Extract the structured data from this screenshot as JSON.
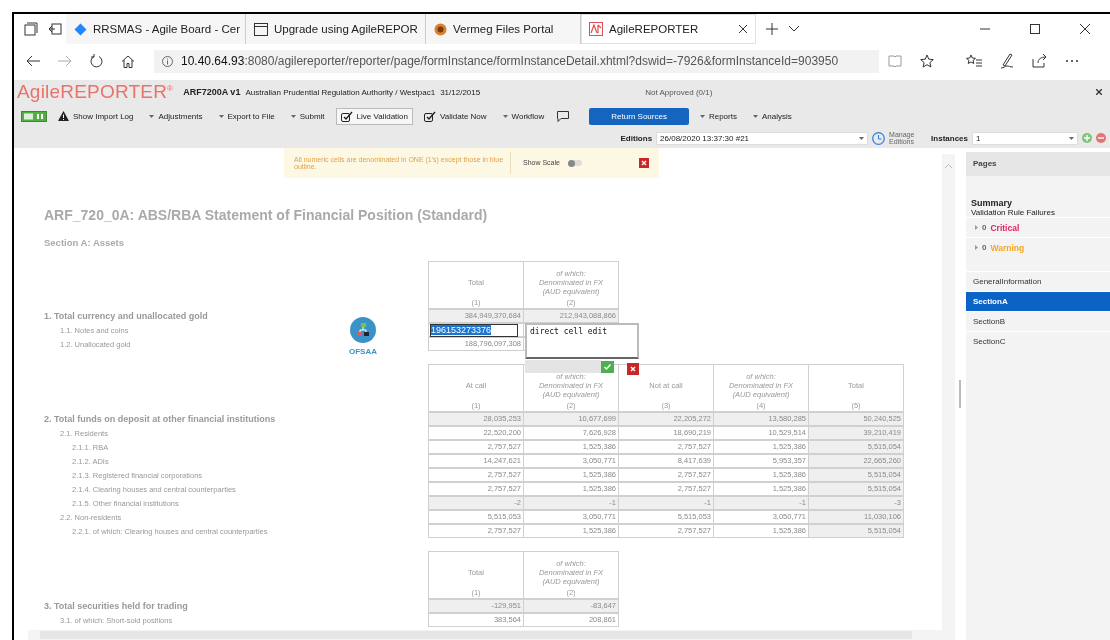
{
  "browser": {
    "tabs": [
      {
        "title": "RRSMAS - Agile Board - Cer",
        "selected": false
      },
      {
        "title": "Upgrade using AgileREPOR",
        "selected": false
      },
      {
        "title": "Vermeg Files Portal",
        "selected": false
      },
      {
        "title": "AgileREPORTER",
        "selected": true
      }
    ],
    "url": {
      "host": "10.40.64.93",
      "path": ":8080/agilereporter/reporter/page/formInstance/formInstanceDetail.xhtml?dswid=-7926&formInstanceId=903950"
    }
  },
  "app": {
    "logo": "AgileREPORTER$^{®}$",
    "form": "ARF7200A v1",
    "entity": "Australian Prudential Regulation Authority / Westpac1",
    "date": "31/12/2015",
    "status": "Not Approved (0/1)"
  },
  "toolbar": [
    {
      "kind": "toggle"
    },
    {
      "kind": "warning",
      "label": "Show Import Log"
    },
    {
      "kind": "menu",
      "label": "Adjustments"
    },
    {
      "kind": "menu",
      "label": "Export to File"
    },
    {
      "kind": "menu",
      "label": "Submit"
    },
    {
      "kind": "validate",
      "label": "Live Validation",
      "pressed": true
    },
    {
      "kind": "validate",
      "label": "Validate Now",
      "pressed": false
    },
    {
      "kind": "menu",
      "label": "Workflow"
    },
    {
      "kind": "comment"
    },
    {
      "kind": "primary",
      "label": "Return Sources"
    },
    {
      "kind": "menu",
      "label": "Reports"
    },
    {
      "kind": "menu",
      "label": "Analysis"
    }
  ],
  "editions": {
    "label": "Editions",
    "value": "26/08/2020 13:37:30 #21",
    "manage": "Manage Editions",
    "instances_label": "Instances",
    "instances_value": "1"
  },
  "notice": {
    "text": "All numeric cells are denominated in ONE (1's) except those in blue outline.",
    "scale_label": "Show Scale",
    "scale_on": false
  },
  "form": {
    "title": "ARF_720_0A: ABS/RBA Statement of Financial Position (Standard)",
    "section": "Section A: Assets",
    "blocks": [
      {
        "badge": {
          "label": "OFSAA"
        },
        "columns": [
          {
            "label": "Total",
            "number": "(1)",
            "kind": "plain",
            "computed": false
          },
          {
            "label": "of which:\nDenominated in FX\n(AUD equivalent)",
            "number": "(2)",
            "kind": "italic",
            "computed": false
          }
        ],
        "rows": [
          {
            "label": "1. Total currency and unallocated gold",
            "values": [
              "384,949,370,684",
              "212,943,088,866"
            ],
            "computed": true,
            "children": [
              {
                "label": "1.1. Notes and coins",
                "computed": false,
                "editor": {
                  "value": "196153273376",
                  "comment": "direct cell edit"
                }
              },
              {
                "label": "1.2. Unallocated gold",
                "values": [
                  "188,796,097,308"
                ],
                "computed": false
              }
            ]
          }
        ]
      },
      {
        "columns": [
          {
            "label": "At call",
            "number": "(1)",
            "kind": "plain",
            "computed": false
          },
          {
            "label": "of which:\nDenominated in FX\n(AUD equivalent)",
            "number": "(2)",
            "kind": "italic",
            "computed": false
          },
          {
            "label": "Not at call",
            "number": "(3)",
            "kind": "plain",
            "computed": false
          },
          {
            "label": "of which:\nDenominated in FX\n(AUD equivalent)",
            "number": "(4)",
            "kind": "italic",
            "computed": false
          },
          {
            "label": "Total",
            "number": "(5)",
            "kind": "plain",
            "computed": true
          }
        ],
        "rows": [
          {
            "label": "2. Total funds on deposit at other financial institutions",
            "values": [
              "28,035,253",
              "10,677,699",
              "22,205,272",
              "13,580,285",
              "50,240,525"
            ],
            "computed": true,
            "children": [
              {
                "label": "2.1. Residents",
                "values": [
                  "22,520,200",
                  "7,626,928",
                  "18,690,219",
                  "10,529,514",
                  "39,210,419"
                ],
                "computed": false,
                "children": [
                  {
                    "label": "2.1.1. RBA",
                    "values": [
                      "2,757,527",
                      "1,525,386",
                      "2,757,527",
                      "1,525,386",
                      "5,515,054"
                    ],
                    "computed": false
                  },
                  {
                    "label": "2.1.2. ADIs",
                    "values": [
                      "14,247,621",
                      "3,050,771",
                      "8,417,639",
                      "5,953,357",
                      "22,665,260"
                    ],
                    "computed": false
                  },
                  {
                    "label": "2.1.3. Registered financial corporations",
                    "values": [
                      "2,757,527",
                      "1,525,386",
                      "2,757,527",
                      "1,525,386",
                      "5,515,054"
                    ],
                    "computed": false
                  },
                  {
                    "label": "2.1.4. Clearing houses and central counterparties",
                    "values": [
                      "2,757,527",
                      "1,525,386",
                      "2,757,527",
                      "1,525,386",
                      "5,515,054"
                    ],
                    "computed": false
                  },
                  {
                    "label": "2.1.5. Other financial institutions",
                    "values": [
                      "-2",
                      "-1",
                      "-1",
                      "-1",
                      "-3"
                    ],
                    "computed": true
                  }
                ]
              },
              {
                "label": "2.2. Non-residents",
                "values": [
                  "5,515,053",
                  "3,050,771",
                  "5,515,053",
                  "3,050,771",
                  "11,030,106"
                ],
                "computed": false,
                "children": [
                  {
                    "label": "2.2.1. of which: Clearing houses and central counterparties",
                    "values": [
                      "2,757,527",
                      "1,525,386",
                      "2,757,527",
                      "1,525,386",
                      "5,515,054"
                    ],
                    "computed": false
                  }
                ]
              }
            ]
          }
        ]
      },
      {
        "columns": [
          {
            "label": "Total",
            "number": "(1)",
            "kind": "plain",
            "computed": false
          },
          {
            "label": "of which:\nDenominated in FX\n(AUD equivalent)",
            "number": "(2)",
            "kind": "italic",
            "computed": false
          }
        ],
        "rows": [
          {
            "label": "3. Total securities held for trading",
            "values": [
              "-129,951",
              "-83,647"
            ],
            "computed": true,
            "children": [
              {
                "label": "3.1. of which: Short-sold positions",
                "values": [
                  "383,564",
                  "208,861"
                ],
                "computed": false
              }
            ]
          }
        ]
      }
    ]
  },
  "sidebar": {
    "header": "Pages",
    "summary": "Summary",
    "failures_label": "Validation Rule Failures",
    "failures": [
      {
        "count": "0",
        "label": "Critical",
        "color": "#e0245e"
      },
      {
        "count": "0",
        "label": "Warning",
        "color": "#f5a623"
      }
    ],
    "pages": [
      {
        "label": "GeneralInformation",
        "selected": false
      },
      {
        "label": "SectionA",
        "selected": true
      },
      {
        "label": "SectionB",
        "selected": false
      },
      {
        "label": "SectionC",
        "selected": false
      }
    ]
  }
}
